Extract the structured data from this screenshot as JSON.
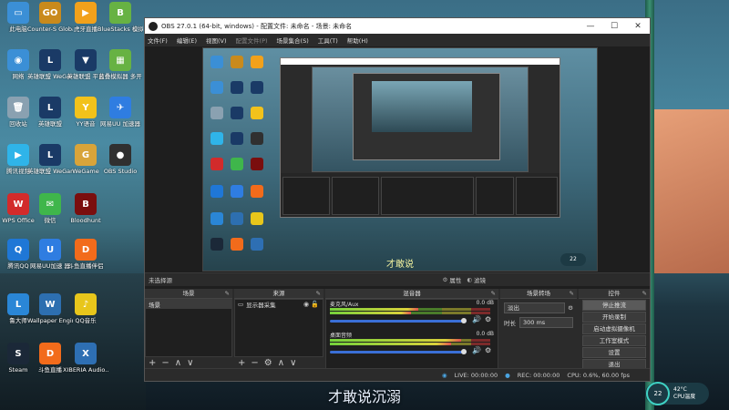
{
  "desktop": {
    "icons": [
      {
        "label": "此电脑",
        "color": "#3b8fd6",
        "glyph": "▭"
      },
      {
        "label": "Counter-S\nGlobal Of",
        "color": "#c98a1c",
        "glyph": "GO"
      },
      {
        "label": "虎牙直播",
        "color": "#f2a11b",
        "glyph": "▶"
      },
      {
        "label": "BlueStacks\n模拟",
        "color": "#67b243",
        "glyph": "B"
      },
      {
        "label": "网络",
        "color": "#3b8fd6",
        "glyph": "◉"
      },
      {
        "label": "英雄联盟\nWeGame版",
        "color": "#1a3a66",
        "glyph": "L"
      },
      {
        "label": "英雄联盟\n平台",
        "color": "#1a3a66",
        "glyph": "▼"
      },
      {
        "label": "蓝叠模拟器\n多开",
        "color": "#67b243",
        "glyph": "▦"
      },
      {
        "label": "回收站",
        "color": "#8aa1b1",
        "glyph": "🗑"
      },
      {
        "label": "英雄联盟",
        "color": "#1a3a66",
        "glyph": "L"
      },
      {
        "label": "YY语音",
        "color": "#f2c21b",
        "glyph": "Y"
      },
      {
        "label": "网易UU\n加速器",
        "color": "#2f7de1",
        "glyph": "✈"
      },
      {
        "label": "腾讯视频",
        "color": "#2fb4e9",
        "glyph": "▶"
      },
      {
        "label": "英雄联盟\nWeGame",
        "color": "#1a3a66",
        "glyph": "L"
      },
      {
        "label": "WeGame",
        "color": "#d8a43a",
        "glyph": "G"
      },
      {
        "label": "OBS Studio",
        "color": "#303030",
        "glyph": "●"
      },
      {
        "label": "WPS Office",
        "color": "#d22b2b",
        "glyph": "W"
      },
      {
        "label": "微信",
        "color": "#3fb64b",
        "glyph": "✉"
      },
      {
        "label": "Bloodhunt",
        "color": "#7a0e0e",
        "glyph": "B"
      },
      {
        "label": "腾讯QQ",
        "color": "#1f77d6",
        "glyph": "Q"
      },
      {
        "label": "网易UU加速\n器",
        "color": "#2f7de1",
        "glyph": "U"
      },
      {
        "label": "斗鱼直播伴侣",
        "color": "#f26b1b",
        "glyph": "D"
      },
      {
        "label": "鲁大师",
        "color": "#2a86d6",
        "glyph": "L"
      },
      {
        "label": "Wallpaper\nEngine:...",
        "color": "#2d6fb0",
        "glyph": "W"
      },
      {
        "label": "QQ音乐",
        "color": "#e8c61b",
        "glyph": "♪"
      },
      {
        "label": "Steam",
        "color": "#1b2838",
        "glyph": "S"
      },
      {
        "label": "斗鱼直播",
        "color": "#f26b1b",
        "glyph": "D"
      },
      {
        "label": "XIBERIA\nAudio...",
        "color": "#2e6fb3",
        "glyph": "X"
      }
    ]
  },
  "window": {
    "title": "OBS 27.0.1 (64-bit, windows) - 配置文件: 未命名 - 场景: 未命名",
    "minimize": "—",
    "maximize": "☐",
    "close": "✕"
  },
  "menu": {
    "items": [
      "文件(F)",
      "编辑(E)",
      "视图(V)",
      "配置文件(P)",
      "场景集合(S)",
      "工具(T)",
      "帮助(H)"
    ]
  },
  "preview": {
    "subtitle": "才敢说",
    "badge": "22"
  },
  "scene_toolbar": {
    "no_source": "未选择源",
    "properties": "属性",
    "filters": "滤镜"
  },
  "docks": {
    "scenes": {
      "title": "场景",
      "items": [
        "场景"
      ]
    },
    "sources": {
      "title": "来源",
      "items": [
        "显示器采集"
      ]
    },
    "mixer": {
      "title": "混音器",
      "channels": [
        {
          "name": "麦克风/Aux",
          "db": "0.0 dB",
          "level": 0.55,
          "volume": 0.98
        },
        {
          "name": "桌面音频",
          "db": "0.0 dB",
          "level": 0.82,
          "volume": 0.98
        }
      ]
    },
    "transitions": {
      "title": "场景转场",
      "type": "淡出",
      "duration_label": "时长",
      "duration_value": "300 ms"
    },
    "controls": {
      "title": "控件",
      "buttons": [
        "停止推流",
        "开始录制",
        "启动虚拟摄像机",
        "工作室模式",
        "设置",
        "退出"
      ]
    }
  },
  "status": {
    "live": "LIVE: 00:00:00",
    "rec": "REC: 00:00:00",
    "cpu": "CPU: 0.6%, 60.00 fps"
  },
  "footer_icons": {
    "add": "+",
    "remove": "−",
    "up": "∧",
    "down": "∨",
    "gear": "⚙"
  },
  "overlay": {
    "subtitle": "才敢说沉溺"
  },
  "cpu_widget": {
    "usage": "22",
    "temp": "42°C",
    "label": "CPU温度"
  }
}
